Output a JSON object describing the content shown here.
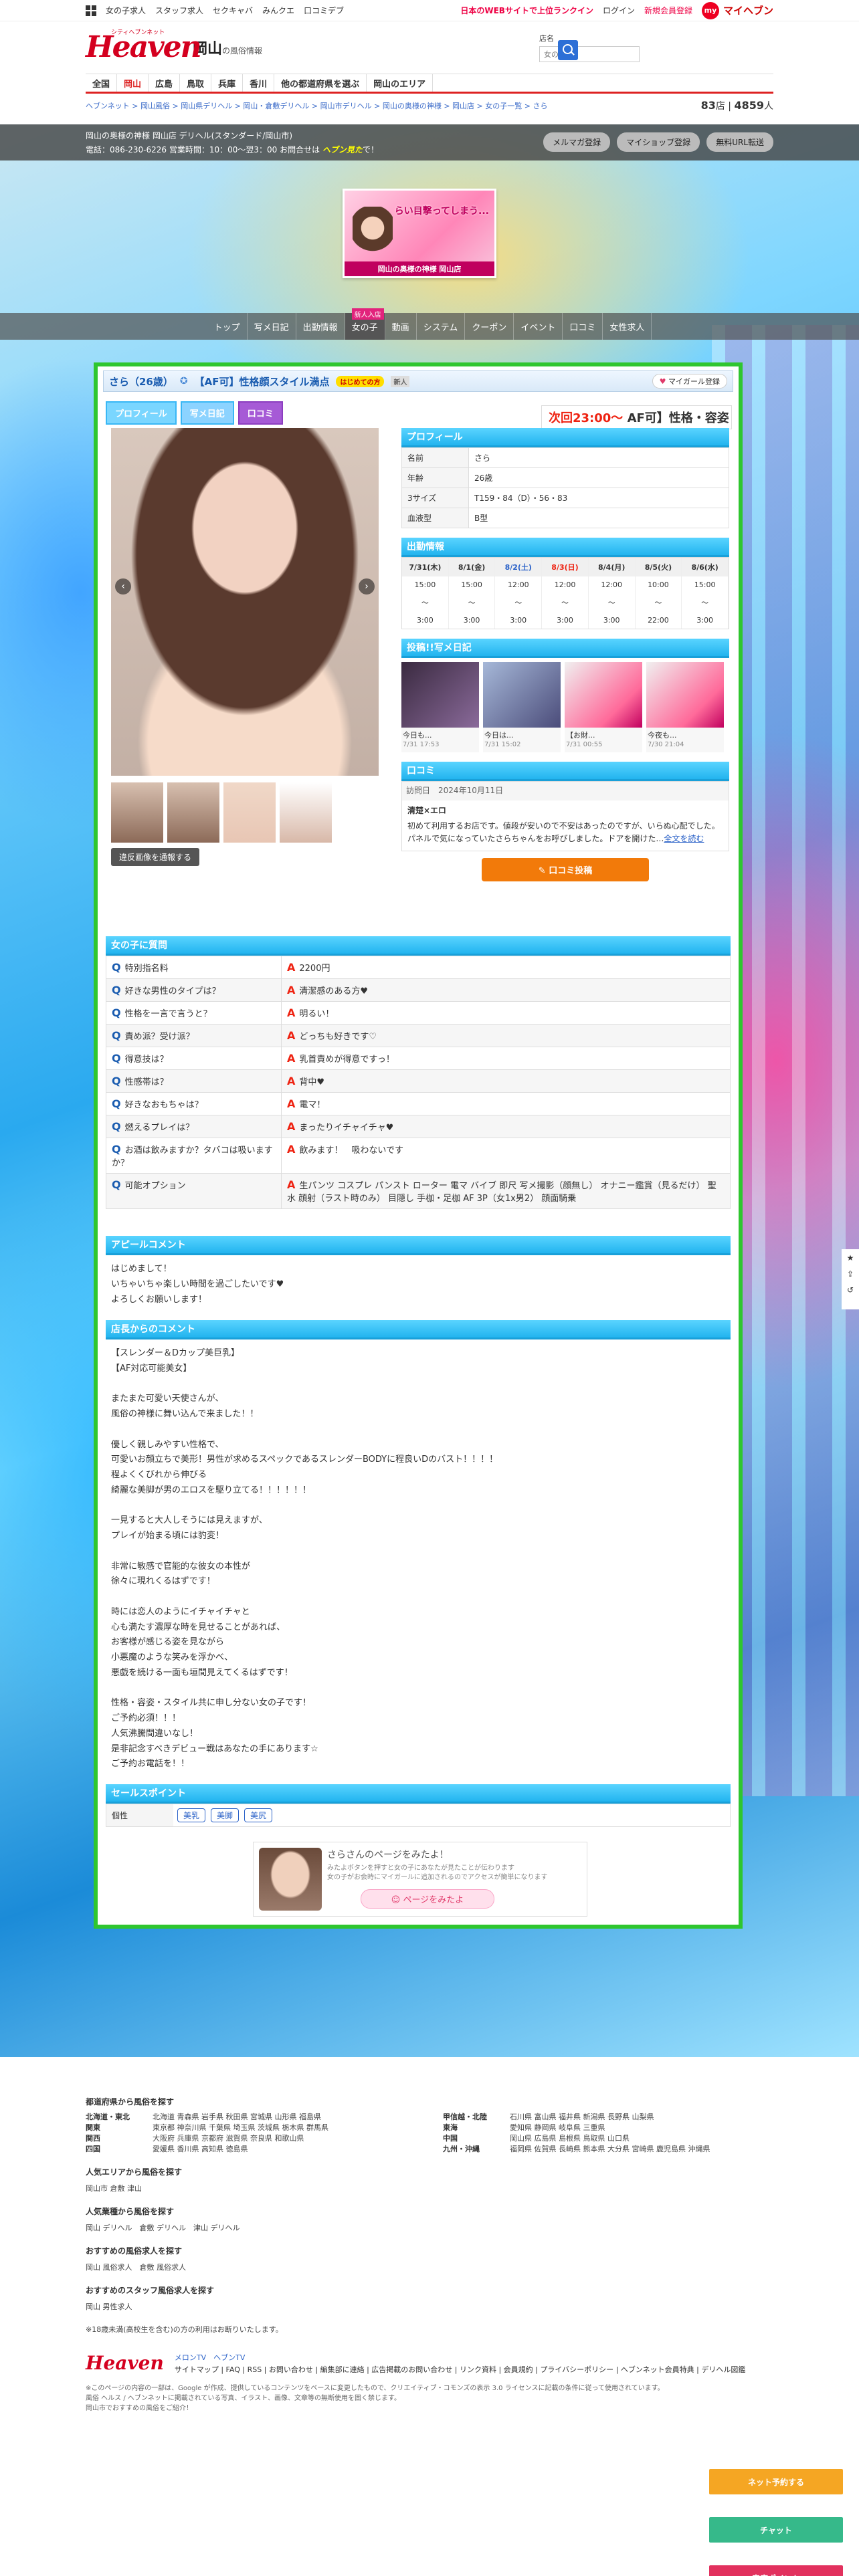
{
  "topbar": {
    "links": [
      "女の子求人",
      "スタッフ求人",
      "セクキャバ",
      "みんクエ",
      "口コミデブ"
    ],
    "rank_text": "日本のWEBサイトで上位ランクイン",
    "login": "ログイン",
    "register": "新規会員登録",
    "myheaven": "マイヘブン"
  },
  "header": {
    "logo_sub": "シティヘブンネット",
    "logo": "Heaven",
    "area": "岡山",
    "area_sub": "の風俗情報",
    "search_label": "店名",
    "search_placeholder": "女の子名"
  },
  "gnav": [
    "全国",
    "岡山",
    "広島",
    "鳥取",
    "兵庫",
    "香川",
    "他の都道府県を選ぶ",
    "岡山のエリア"
  ],
  "breadcrumb": "ヘブンネット > 岡山風俗 > 岡山県デリヘル > 岡山・倉敷デリヘル > 岡山市デリヘル > 岡山の奥様の神様 > 岡山店 > 女の子一覧 > さら",
  "counter": {
    "a": "83",
    "a_unit": "店",
    "b": "4859",
    "b_unit": "人"
  },
  "shop": {
    "line1": "岡山の奥様の神様 岡山店 デリヘル(スタンダード/岡山市)",
    "line2": "電話：086-230-6226 営業時間：10：00〜翌3：00 お問合せは",
    "line2_em": "ヘブン見た",
    "line2_end": "で！",
    "btns": [
      "メルマガ登録",
      "マイショップ登録",
      "無料URL転送"
    ]
  },
  "banner": {
    "text": "らい目撃ってしまう...",
    "bottom": "岡山の奥様の神様 岡山店"
  },
  "shopnav": [
    "トップ",
    "写メ日記",
    "出勤情報",
    "女の子",
    "動画",
    "システム",
    "クーポン",
    "イベント",
    "口コミ",
    "女性求人"
  ],
  "girl": {
    "name": "さら（26歳）",
    "tag": "【AF可】性格顔スタイル満点",
    "badge1": "はじめての方",
    "badge2": "新人",
    "mygirl": "マイガール登録",
    "tabs": [
      "プロフィール",
      "写メ日記",
      "口コミ"
    ],
    "marquee_time": "次回23:00〜",
    "marquee_text": "AF可】性格・容姿・",
    "report": "違反画像を通報する"
  },
  "profile": {
    "heading": "プロフィール",
    "rows": [
      {
        "k": "名前",
        "v": "さら"
      },
      {
        "k": "年齢",
        "v": "26歳"
      },
      {
        "k": "3サイズ",
        "v": "T159・84（D）・56・83"
      },
      {
        "k": "血液型",
        "v": "B型"
      }
    ]
  },
  "schedule": {
    "heading": "出勤情報",
    "days": [
      "7/31(木)",
      "8/1(金)",
      "8/2(土)",
      "8/3(日)",
      "8/4(月)",
      "8/5(火)",
      "8/6(水)"
    ],
    "start": [
      "15:00",
      "15:00",
      "12:00",
      "12:00",
      "12:00",
      "10:00",
      "15:00"
    ],
    "end": [
      "3:00",
      "3:00",
      "3:00",
      "3:00",
      "3:00",
      "22:00",
      "3:00"
    ]
  },
  "diary": {
    "heading": "投稿!!写メ日記",
    "posts": [
      {
        "title": "今日も...",
        "date": "7/31 17:53"
      },
      {
        "title": "今日は...",
        "date": "7/31 15:02"
      },
      {
        "title": "【お財...",
        "date": "7/31 00:55"
      },
      {
        "title": "今夜も...",
        "date": "7/30 21:04"
      }
    ]
  },
  "review": {
    "heading": "口コミ",
    "date_label": "訪問日",
    "date": "2024年10月11日",
    "title": "清楚×エロ",
    "body": "初めて利用するお店です。値段が安いので不安はあったのですが、いらぬ心配でした。パネルで気になっていたさらちゃんをお呼びしました。ドアを開けた…",
    "more": "全文を読む",
    "post_btn": "口コミ投稿"
  },
  "qa": {
    "heading": "女の子に質問",
    "items": [
      {
        "q": "特別指名料",
        "a": "2200円"
      },
      {
        "q": "好きな男性のタイプは？",
        "a": "清潔感のある方♥"
      },
      {
        "q": "性格を一言で言うと？",
        "a": "明るい！"
      },
      {
        "q": "責め派？受け派？",
        "a": "どっちも好きです♡"
      },
      {
        "q": "得意技は？",
        "a": "乳首責めが得意ですっ！"
      },
      {
        "q": "性感帯は？",
        "a": "背中♥"
      },
      {
        "q": "好きなおもちゃは？",
        "a": "電マ！"
      },
      {
        "q": "燃えるプレイは？",
        "a": "まったりイチャイチャ♥"
      },
      {
        "q": "お酒は飲みますか？タバコは吸いますか？",
        "a": "飲みます！　吸わないです"
      },
      {
        "q": "可能オプション",
        "a": "生パンツ コスプレ パンスト ローター 電マ バイブ 即尺 写メ撮影（顔無し） オナニー鑑賞（見るだけ） 聖水 顔射（ラスト時のみ） 目隠し 手枷・足枷 AF 3P（女1x男2） 顔面騎乗"
      }
    ]
  },
  "appeal": {
    "heading": "アピールコメント",
    "text": "はじめまして！\nいちゃいちゃ楽しい時間を過ごしたいです♥\nよろしくお願いします！"
  },
  "shopcomment": {
    "heading": "店長からのコメント",
    "text": "【スレンダー＆Dカップ美巨乳】\n【AF対応可能美女】\n\nまたまた可愛い天使さんが、\n風俗の神様に舞い込んで来ました！！\n\n優しく親しみやすい性格で、\n可愛いお顔立ちで美形！男性が求めるスペックであるスレンダーBODYに程良いDのバスト！！！！\n程よくくびれから伸びる\n綺麗な美脚が男のエロスを駆り立てる！！！！！！\n\n一見すると大人しそうには見えますが、\nプレイが始まる頃には豹変！\n\n非常に敏感で官能的な彼女の本性が\n徐々に現れくるはずです！\n\n時には恋人のようにイチャイチャと\n心も満たす濃厚な時を見せることがあれば、\nお客様が感じる姿を見ながら\n小悪魔のような笑みを浮かべ、\n悪戯を続ける一面も垣間見えてくるはずです！\n\n性格・容姿・スタイル共に申し分ない女の子です！\nご予約必須！！！\n人気沸騰間違いなし！\n是非記念すべきデビュー戦はあなたの手にあります☆\nご予約お電話を！！"
  },
  "salespoint": {
    "heading": "セールスポイント",
    "key": "個性",
    "tags": [
      "美乳",
      "美脚",
      "美尻"
    ]
  },
  "seen": {
    "title": "さらさんのページをみたよ！",
    "desc": "みたよボタンを押すと女の子にあなたが見たことが伝わります\n女の子がお会時にマイガールに追加されるのでアクセスが簡単になります",
    "btn": "ページをみたよ"
  },
  "footer": {
    "pref_heading": "都道府県から風俗を探す",
    "prefs_left": [
      {
        "r": "北海道・東北",
        "p": "北海道 青森県 岩手県 秋田県 宮城県 山形県 福島県"
      },
      {
        "r": "関東",
        "p": "東京都 神奈川県 千葉県 埼玉県 茨城県 栃木県 群馬県"
      },
      {
        "r": "関西",
        "p": "大阪府 兵庫県 京都府 滋賀県 奈良県 和歌山県"
      },
      {
        "r": "四国",
        "p": "愛媛県 香川県 高知県 徳島県"
      }
    ],
    "prefs_right": [
      {
        "r": "甲信越・北陸",
        "p": "石川県 富山県 福井県 新潟県 長野県 山梨県"
      },
      {
        "r": "東海",
        "p": "愛知県 静岡県 岐阜県 三重県"
      },
      {
        "r": "中国",
        "p": "岡山県 広島県 島根県 鳥取県 山口県"
      },
      {
        "r": "九州・沖縄",
        "p": "福岡県 佐賀県 長崎県 熊本県 大分県 宮崎県 鹿児島県 沖縄県"
      }
    ],
    "area_heading": "人気エリアから風俗を探す",
    "area_links": "岡山市 倉敷 津山",
    "type_heading": "人気業種から風俗を探す",
    "type_links": "岡山 デリヘル　倉敷 デリヘル　津山 デリヘル",
    "job_heading": "おすすめの風俗求人を探す",
    "job_links": "岡山 風俗求人　倉敷 風俗求人",
    "staff_heading": "おすすめのスタッフ風俗求人を探す",
    "staff_links": "岡山 男性求人",
    "age_note": "※18歳未満(高校生を含む)の方の利用はお断りいたします。",
    "tv": "メロンTV　ヘブンTV",
    "links": "サイトマップ | FAQ | RSS | お問い合わせ | 編集部に連絡 | 広告掲載のお問い合わせ | リンク資料 | 会員規約 | プライバシーポリシー | ヘブンネット会員特典 | デリヘル図鑑",
    "note": "※このページの内容の一部は、Google が作成、提供しているコンテンツをベースに変更したもので、クリエイティブ・コモンズの表示 3.0 ライセンスに記載の条件に従って使用されています。\n風俗 ヘルス / ヘブンネットに掲載されている写真、イラスト、画像、文章等の無断使用を固く禁じます。\n岡山市でおすすめの風俗をご紹介！"
  },
  "float": [
    "ネット予約する",
    "チャット",
    "来店ポイント"
  ]
}
